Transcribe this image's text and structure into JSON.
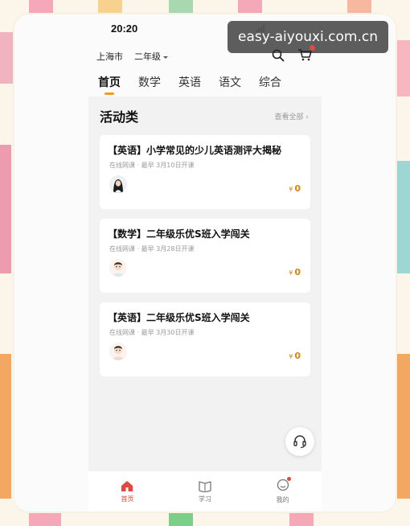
{
  "status": {
    "time": "20:20"
  },
  "watermark": "easy-aiyouxi.com.cn",
  "location": {
    "city": "上海市",
    "grade": "二年级"
  },
  "icons": {
    "search": "search-icon",
    "cart": "cart-icon",
    "service": "headset-icon"
  },
  "tabs": [
    {
      "label": "首页",
      "active": true
    },
    {
      "label": "数学",
      "active": false
    },
    {
      "label": "英语",
      "active": false
    },
    {
      "label": "语文",
      "active": false
    },
    {
      "label": "综合",
      "active": false
    }
  ],
  "section": {
    "title": "活动类",
    "see_all": "查看全部"
  },
  "courses": [
    {
      "title": "【英语】小学常见的少儿英语测评大揭秘",
      "meta": "在线网课 · 最早 3月10日开课",
      "currency": "¥",
      "price": "0",
      "avatar": "female-teacher-avatar"
    },
    {
      "title": "【数学】二年级乐优S班入学闯关",
      "meta": "在线网课 · 最早 3月28日开课",
      "currency": "¥",
      "price": "0",
      "avatar": "cartoon-teacher-avatar"
    },
    {
      "title": "【英语】二年级乐优S班入学闯关",
      "meta": "在线网课 · 最早 3月30日开课",
      "currency": "¥",
      "price": "0",
      "avatar": "cartoon-teacher-avatar"
    }
  ],
  "bottom_nav": [
    {
      "label": "首页",
      "icon": "home-icon",
      "active": true
    },
    {
      "label": "学习",
      "icon": "book-icon",
      "active": false
    },
    {
      "label": "我的",
      "icon": "smiley-icon",
      "active": false
    }
  ],
  "colors": {
    "accent": "#f29a1f",
    "active_nav": "#e2483d",
    "price": "#d9850f"
  }
}
